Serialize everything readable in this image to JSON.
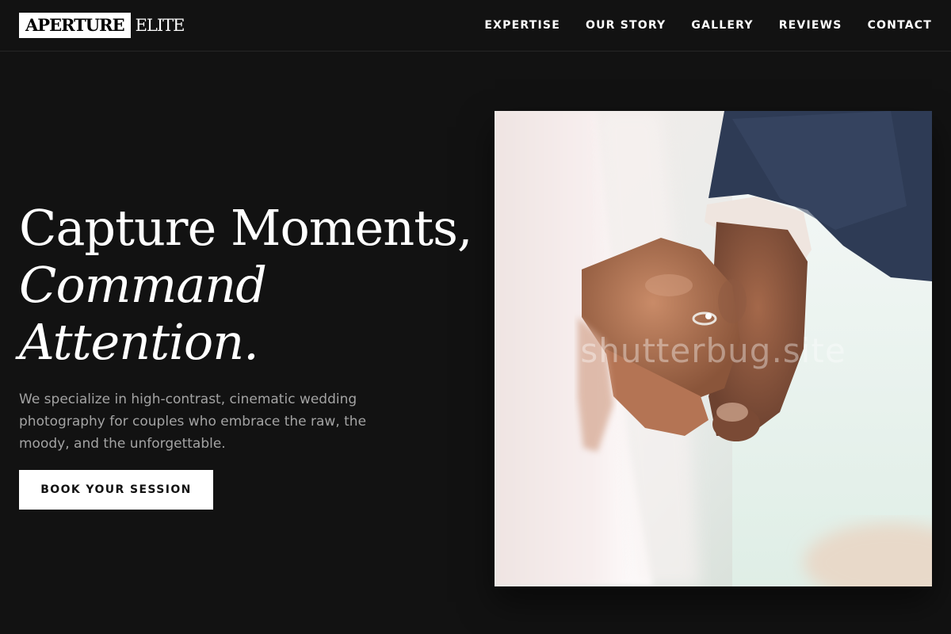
{
  "brand": {
    "logo_boxed": "APERTURE",
    "logo_rest": "ELITE"
  },
  "nav": {
    "items": [
      {
        "label": "EXPERTISE"
      },
      {
        "label": "OUR STORY"
      },
      {
        "label": "GALLERY"
      },
      {
        "label": "REVIEWS"
      },
      {
        "label": "CONTACT"
      }
    ]
  },
  "hero": {
    "title_line1": "Capture Moments,",
    "title_line2": "Command",
    "title_line3": "Attention.",
    "description": "We specialize in high-contrast, cinematic wedding photography for couples who embrace the raw, the moody, and the unforgettable.",
    "cta_label": "BOOK YOUR SESSION",
    "image_watermark": "shutterbug.site",
    "image_alt": "Couple holding hands with engagement ring"
  },
  "colors": {
    "background": "#121212",
    "text": "#ffffff",
    "muted_text": "#a3a3a3",
    "button_bg": "#ffffff",
    "button_text": "#121212"
  }
}
